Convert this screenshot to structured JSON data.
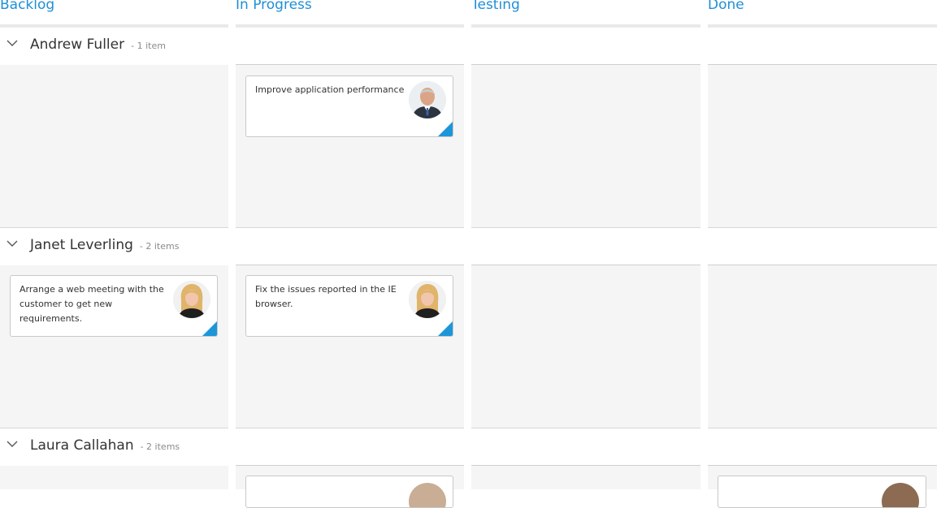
{
  "columns": {
    "backlog": "Backlog",
    "in_progress": "In Progress",
    "testing": "Testing",
    "done": "Done"
  },
  "swimlanes": [
    {
      "name": "Andrew Fuller",
      "count": "- 1 item"
    },
    {
      "name": "Janet Leverling",
      "count": "- 2 items"
    },
    {
      "name": "Laura Callahan",
      "count": "- 2 items"
    }
  ],
  "cards": [
    {
      "text": "Improve application performance",
      "avatar": "andrew-fuller-avatar"
    },
    {
      "text": "Arrange a web meeting with the customer to get new requirements.",
      "avatar": "janet-leverling-avatar"
    },
    {
      "text": "Fix the issues reported in the IE browser.",
      "avatar": "janet-leverling-avatar"
    }
  ],
  "colors": {
    "accent": "#1f8fd6",
    "card_corner": "#1c96d9",
    "cell_background": "#f5f5f5"
  },
  "icons": {
    "swimlane_toggle": "chevron-down-icon"
  }
}
